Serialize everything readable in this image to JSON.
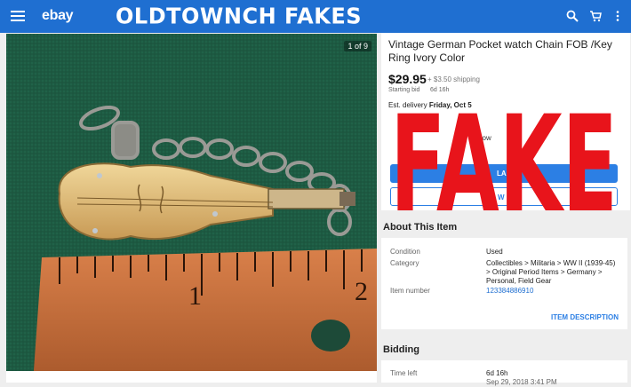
{
  "topbar": {
    "logo": "ebay",
    "banner": "OLDTOWNCH FAKES",
    "icons": [
      "menu-icon",
      "search-icon",
      "cart-icon",
      "more-icon"
    ]
  },
  "photo": {
    "counter": "1 of 9",
    "ruler_numbers": [
      "1",
      "2"
    ]
  },
  "listing": {
    "title": "Vintage German Pocket watch Chain FOB /Key Ring Ivory Color",
    "price": "$29.95",
    "shipping": "+ $3.50 shipping",
    "starting_bid_label": "Starting bid",
    "time_short": "6d 16h",
    "delivery_label": "Est. delivery",
    "delivery_date": "Friday, Oct 5",
    "follow_fragment": "llow",
    "bid_btn_fragment": "LA",
    "watch_btn_fragment": "W"
  },
  "overlay": {
    "stamp": "FAKE",
    "color": "#e8141b"
  },
  "about": {
    "heading": "About This Item",
    "condition_label": "Condition",
    "condition_value": "Used",
    "category_label": "Category",
    "category_value": "Collectibles > Militaria > WW II (1939-45) > Original Period Items > Germany > Personal, Field Gear",
    "item_number_label": "Item number",
    "item_number_value": "123384886910",
    "item_description_link": "ITEM DESCRIPTION"
  },
  "bidding": {
    "heading": "Bidding",
    "time_left_label": "Time left",
    "time_left_value": "6d 16h",
    "end_date_partial": "Sep 29, 2018 3:41 PM"
  },
  "colors": {
    "brand_blue": "#1f6fd1",
    "button_blue": "#2c7fe4"
  }
}
